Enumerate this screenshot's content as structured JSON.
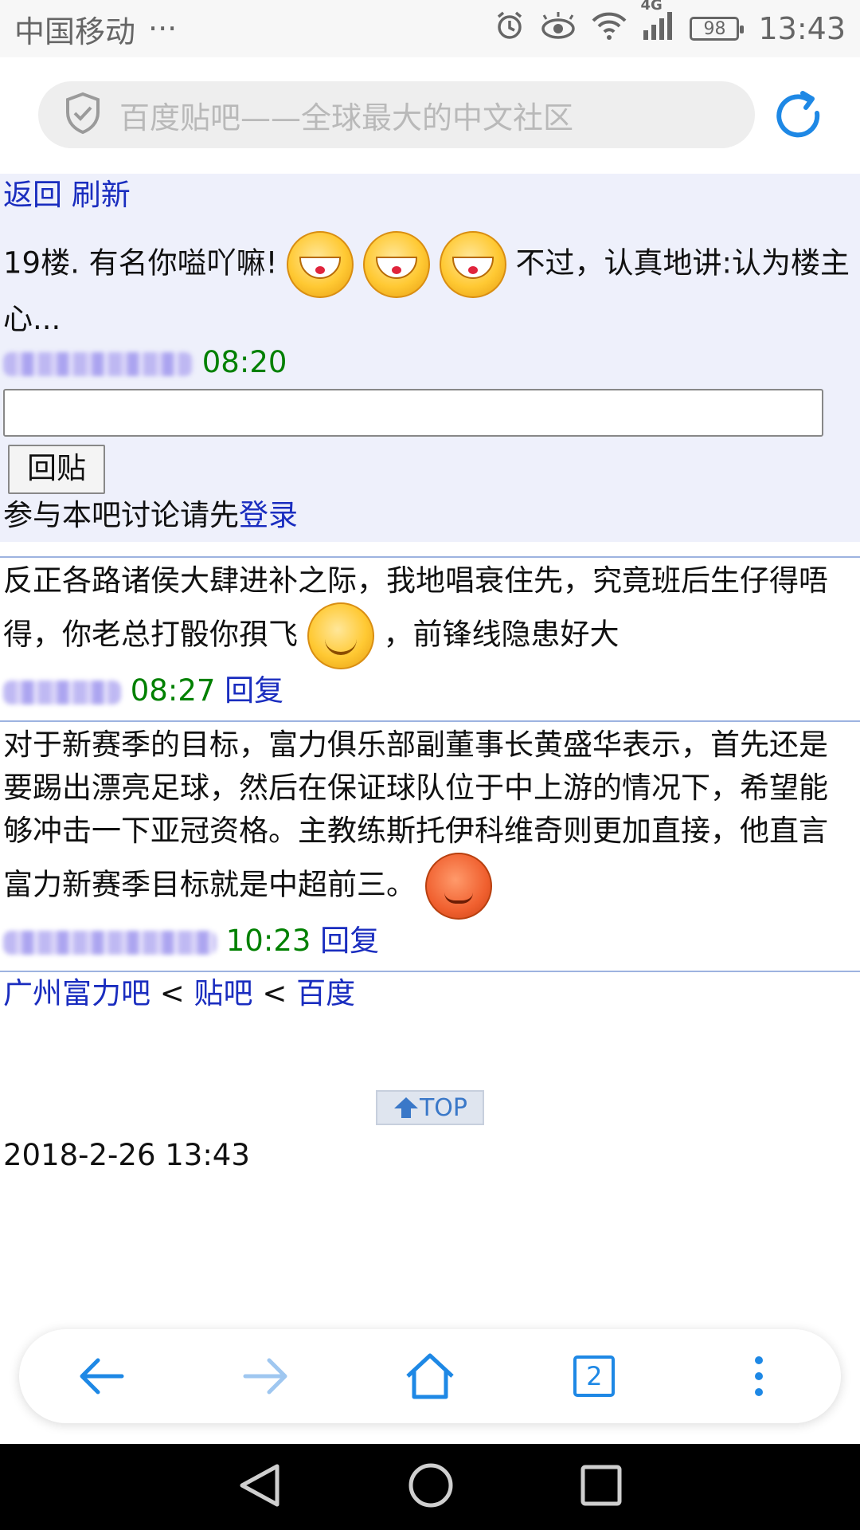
{
  "status_bar": {
    "carrier": "中国移动",
    "dots": "···",
    "network": "4G",
    "battery": "98",
    "time": "13:43"
  },
  "address_bar": {
    "title": "百度贴吧——全球最大的中文社区"
  },
  "top_links": {
    "back": "返回",
    "refresh": "刷新"
  },
  "floor19": {
    "prefix": "19楼. 有名你嗌吖嘛!",
    "suffix": "不过，认真地讲:认为楼主心...",
    "time": "08:20"
  },
  "reply_box": {
    "input_value": "",
    "button": "回贴",
    "login_prompt": "参与本吧讨论请先",
    "login_link": "登录"
  },
  "posts": [
    {
      "text_a": "反正各路诸侯大肆进补之际，我地唱衰住先，究竟班后生仔得唔得，你老总打骰你孭飞",
      "text_b": "，前锋线隐患好大",
      "time": "08:27",
      "reply": "回复"
    },
    {
      "text_a": "对于新赛季的目标，富力俱乐部副董事长黄盛华表示，首先还是要踢出漂亮足球，然后在保证球队位于中上游的情况下，希望能够冲击一下亚冠资格。主教练斯托伊科维奇则更加直接，他直言富力新赛季目标就是中超前三。",
      "time": "10:23",
      "reply": "回复"
    }
  ],
  "breadcrumb": {
    "forum": "广州富力吧",
    "sep": "<",
    "tieba": "贴吧",
    "baidu": "百度"
  },
  "top_button": "TOP",
  "footer_date": "2018-2-26 13:43",
  "toolbar": {
    "tabs_count": "2"
  },
  "colors": {
    "link": "#1a2dbf",
    "time": "#008000",
    "accent": "#1e88e5"
  }
}
